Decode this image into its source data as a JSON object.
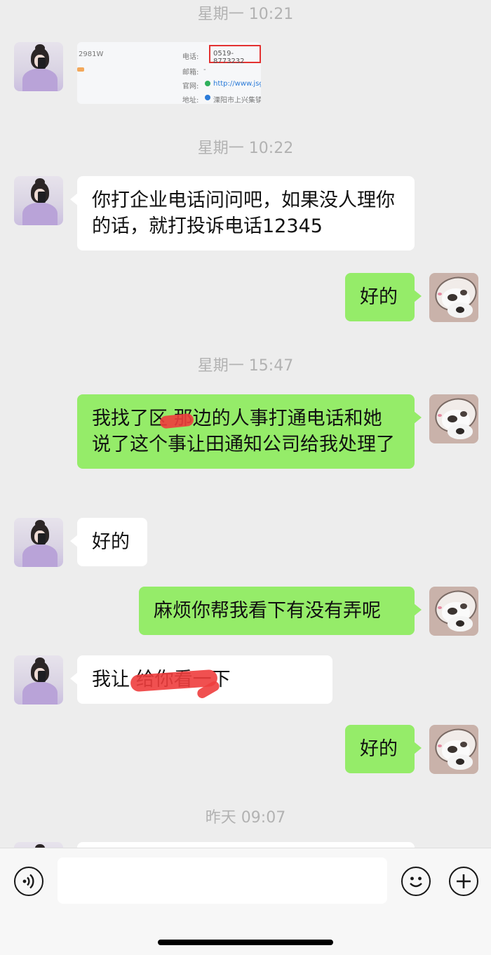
{
  "timestamps": {
    "t1": "星期一 10:21",
    "t2": "星期一 10:22",
    "t3": "星期一 15:47",
    "t4": "昨天 09:07"
  },
  "messages": {
    "m1": {
      "type": "image",
      "snippets": {
        "id_fragment": "2981W",
        "phone_label": "电话:",
        "phone_value": "0519-8773232",
        "email_label": "邮箱:",
        "email_value": "-",
        "site_label": "官网:",
        "site_value": "http://www.jsg",
        "addr_label": "地址:",
        "addr_value": "溧阳市上兴集镇"
      }
    },
    "m2": {
      "text": "你打企业电话问问吧，如果没人理你的话，就打投诉电话12345"
    },
    "m3": {
      "text": "好的"
    },
    "m4": {
      "text": "我找了区      那边的人事打通电话和她说了这个事让田通知公司给我处理了"
    },
    "m5": {
      "text": "好的"
    },
    "m6": {
      "text": "麻烦你帮我看下有没有弄呢"
    },
    "m7": {
      "text": "我让                给你看一下"
    },
    "m8": {
      "text": "好的"
    }
  },
  "input": {
    "placeholder": ""
  },
  "icons": {
    "voice": "voice-input-icon",
    "emoji": "emoji-icon",
    "more": "plus-icon"
  },
  "colors": {
    "background": "#ededed",
    "sent_bubble": "#95ec69",
    "received_bubble": "#ffffff",
    "timestamp": "#b2b2b2",
    "redaction": "#ee3d3d"
  }
}
